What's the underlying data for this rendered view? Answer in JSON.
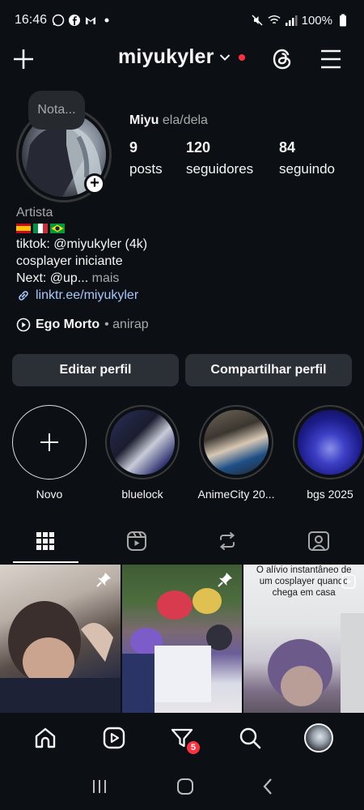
{
  "status_bar": {
    "time": "16:46",
    "battery": "100%"
  },
  "header": {
    "username": "miyukyler",
    "notification_color": "#ff3040"
  },
  "profile": {
    "note": "Nota...",
    "name": "Miyu",
    "pronouns": "ela/dela",
    "stats": [
      {
        "value": "9",
        "label": "posts"
      },
      {
        "value": "120",
        "label": "seguidores"
      },
      {
        "value": "84",
        "label": "seguindo"
      }
    ],
    "category": "Artista",
    "flags": [
      "spain-flag",
      "italy-flag",
      "brazil-flag"
    ],
    "bio_line1": "tiktok: @miyukyler (4k)",
    "bio_line2": "cosplayer iniciante",
    "bio_line3": "Next: @up...",
    "bio_more": "mais",
    "link": "linktr.ee/miyukyler",
    "music_title": "Ego Morto",
    "music_artist": "• anirap"
  },
  "buttons": {
    "edit": "Editar perfil",
    "share": "Compartilhar perfil"
  },
  "highlights": [
    {
      "label": "Novo"
    },
    {
      "label": "bluelock"
    },
    {
      "label": "AnimeCity 20..."
    },
    {
      "label": "bgs 2025"
    }
  ],
  "tabs": [
    "grid-icon",
    "reels-icon",
    "reposts-icon",
    "tagged-icon"
  ],
  "posts": [
    {
      "caption": "",
      "pinned": true
    },
    {
      "caption": "",
      "pinned": true
    },
    {
      "caption": "O alívio instantâneo de um cosplayer quando chega em casa",
      "pinned": false
    }
  ],
  "bottom_nav": {
    "items": [
      "home-icon",
      "reels-icon",
      "activity-icon",
      "search-icon",
      "profile-avatar"
    ],
    "badge": "5"
  }
}
